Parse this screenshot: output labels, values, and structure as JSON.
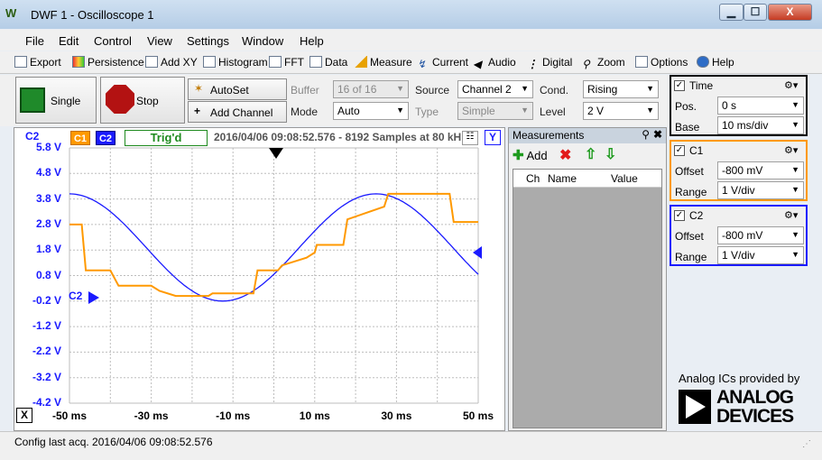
{
  "window": {
    "title": "DWF 1 - Oscilloscope 1",
    "min": "▁",
    "max": "☐",
    "close": "X"
  },
  "menu": [
    "File",
    "Edit",
    "Control",
    "View",
    "Settings",
    "Window",
    "Help"
  ],
  "toolbar": [
    "Export",
    "Persistence",
    "Add XY",
    "Histogram",
    "FFT",
    "Data",
    "Measure",
    "Current",
    "Audio",
    "Digital",
    "Zoom",
    "Options",
    "Help"
  ],
  "controls": {
    "single": "Single",
    "stop": "Stop",
    "autoset": "AutoSet",
    "add_channel": "Add Channel",
    "buffer_label": "Buffer",
    "buffer_value": "16 of 16",
    "mode_label": "Mode",
    "mode_value": "Auto",
    "source_label": "Source",
    "source_value": "Channel 2",
    "type_label": "Type",
    "type_value": "Simple",
    "cond_label": "Cond.",
    "cond_value": "Rising",
    "level_label": "Level",
    "level_value": "2 V"
  },
  "plot": {
    "c1_tag": "C1",
    "c2_tag": "C2",
    "channel_label": "C2",
    "trig_status": "Trig'd",
    "info": "2016/04/06 09:08:52.576 - 8192 Samples at 80 kH",
    "y_btn": "Y",
    "x_btn": "X",
    "marker_label": "C2",
    "y_ticks": [
      "5.8 V",
      "4.8 V",
      "3.8 V",
      "2.8 V",
      "1.8 V",
      "0.8 V",
      "-0.2 V",
      "-1.2 V",
      "-2.2 V",
      "-3.2 V",
      "-4.2 V"
    ],
    "x_ticks": [
      "-50 ms",
      "-30 ms",
      "-10 ms",
      "10 ms",
      "30 ms",
      "50 ms"
    ],
    "colors": {
      "c1": "#ff9900",
      "c2": "#1a1aff",
      "grid": "#bdbdbd"
    }
  },
  "chart_data": {
    "type": "line",
    "xlim": [
      -50,
      50
    ],
    "ylim": [
      -4.2,
      5.8
    ],
    "series": [
      {
        "name": "C2",
        "values_desc": "sine",
        "amplitude": 2.1,
        "offset": 1.9,
        "period_ms": 75,
        "peak_ms": 25
      },
      {
        "name": "C1",
        "x": [
          -50,
          -47,
          -46,
          -40,
          -38,
          -30,
          -28,
          -24,
          -20,
          -16,
          -15,
          -5,
          -4,
          1,
          2,
          8,
          10,
          10.5,
          17,
          18,
          27,
          28,
          43,
          44,
          50
        ],
        "y": [
          2.8,
          2.8,
          1.0,
          1.0,
          0.4,
          0.4,
          0.2,
          0.0,
          0.0,
          0.0,
          0.1,
          0.1,
          1.0,
          1.0,
          1.2,
          1.5,
          1.7,
          2.0,
          2.0,
          3.0,
          3.5,
          4.0,
          4.0,
          2.9,
          2.9
        ]
      }
    ]
  },
  "measurements": {
    "title": "Measurements",
    "add": "Add",
    "col_ch": "Ch",
    "col_name": "Name",
    "col_value": "Value"
  },
  "time": {
    "title": "Time",
    "pos_label": "Pos.",
    "pos_value": "0 s",
    "base_label": "Base",
    "base_value": "10 ms/div"
  },
  "c1": {
    "title": "C1",
    "offset_label": "Offset",
    "offset_value": "-800 mV",
    "range_label": "Range",
    "range_value": "1 V/div"
  },
  "c2": {
    "title": "C2",
    "offset_label": "Offset",
    "offset_value": "-800 mV",
    "range_label": "Range",
    "range_value": "1 V/div"
  },
  "ad": {
    "tagline": "Analog ICs provided by",
    "line1": "ANALOG",
    "line2": "DEVICES"
  },
  "status": "Config last acq. 2016/04/06  09:08:52.576"
}
